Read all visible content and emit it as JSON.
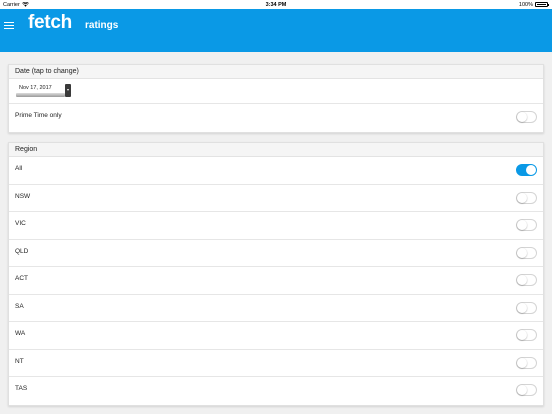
{
  "status_bar": {
    "carrier": "Carrier",
    "time": "3:34 PM",
    "battery_text": "100%"
  },
  "app_bar": {
    "logo": "fetch",
    "title": "ratings",
    "background": "#0a99e6"
  },
  "date_section": {
    "header": "Date (tap to change)",
    "date_value": "Nov 17, 2017",
    "prime_time_label": "Prime Time only",
    "prime_time_on": false
  },
  "region_section": {
    "header": "Region",
    "items": [
      {
        "label": "All",
        "on": true
      },
      {
        "label": "NSW",
        "on": false
      },
      {
        "label": "VIC",
        "on": false
      },
      {
        "label": "QLD",
        "on": false
      },
      {
        "label": "ACT",
        "on": false
      },
      {
        "label": "SA",
        "on": false
      },
      {
        "label": "WA",
        "on": false
      },
      {
        "label": "NT",
        "on": false
      },
      {
        "label": "TAS",
        "on": false
      }
    ]
  },
  "colors": {
    "accent": "#0a99e6",
    "page_background": "#f0f0f0"
  }
}
